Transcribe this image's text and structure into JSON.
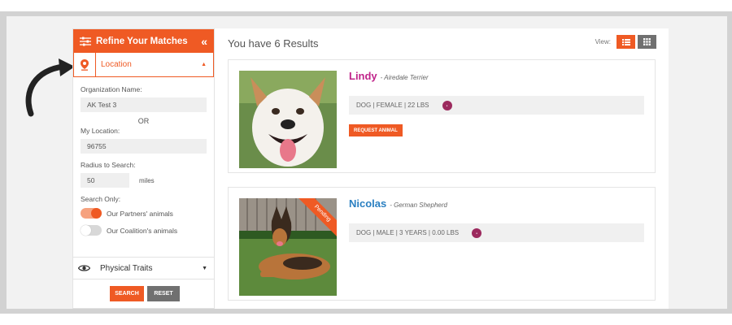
{
  "sidebar": {
    "title": "Refine Your Matches",
    "collapse_icon": "«",
    "location_label": "Location",
    "org_name_label": "Organization Name:",
    "org_name_value": "AK Test 3",
    "or_text": "OR",
    "my_location_label": "My Location:",
    "my_location_value": "96755",
    "radius_label": "Radius to Search:",
    "radius_value": "50",
    "radius_unit": "miles",
    "search_only_label": "Search Only:",
    "toggles": [
      {
        "label": "Our Partners' animals",
        "on": true
      },
      {
        "label": "Our Coalition's animals",
        "on": false
      }
    ],
    "traits_label": "Physical Traits",
    "search_button": "SEARCH",
    "reset_button": "RESET"
  },
  "main": {
    "results_title": "You have 6 Results",
    "view_label": "View:",
    "animals": [
      {
        "name": "Lindy",
        "breed": "- Airedale Terrier",
        "info": "DOG | FEMALE | 22 LBS",
        "name_color": "#c0248a",
        "request_button": "REQUEST ANIMAL"
      },
      {
        "name": "Nicolas",
        "breed": "- German Shepherd",
        "info": "DOG | MALE | 3 YEARS | 0.00 LBS",
        "name_color": "#2a7fc1",
        "status": "Pending"
      }
    ]
  },
  "colors": {
    "accent": "#ef5a24",
    "badge": "#9c2a5e"
  },
  "icons": [
    "filter-icon",
    "collapse-icon",
    "location-pin-icon",
    "caret-up-icon",
    "eye-icon",
    "caret-down-icon",
    "list-view-icon",
    "grid-view-icon",
    "arrow-icon"
  ]
}
